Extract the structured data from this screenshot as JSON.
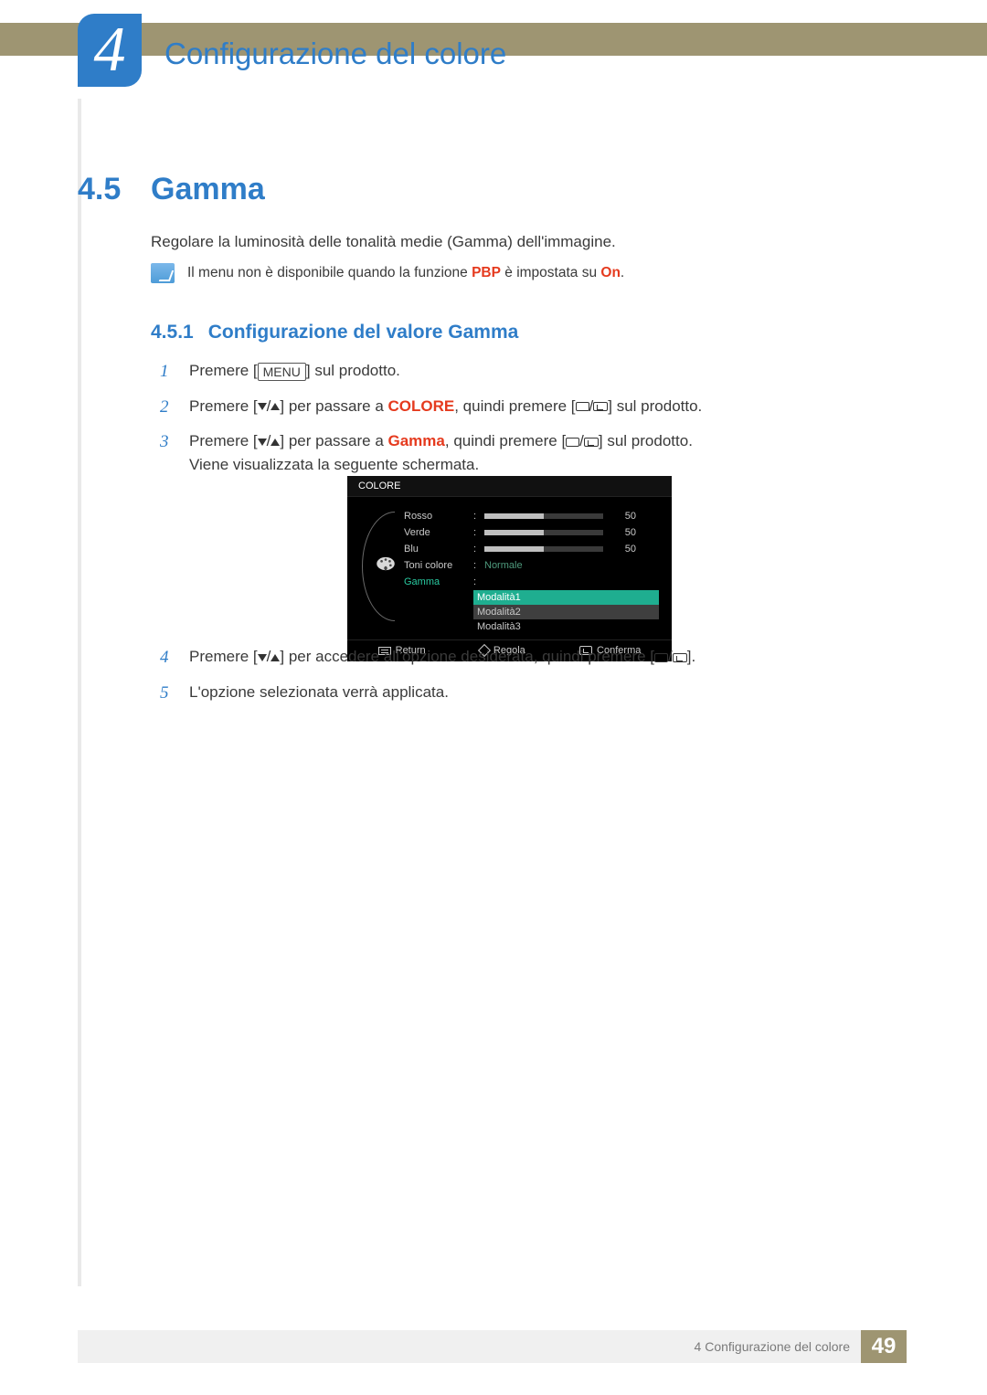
{
  "header": {
    "chapter_number": "4",
    "chapter_title": "Configurazione del colore"
  },
  "section": {
    "number": "4.5",
    "title": "Gamma",
    "intro": "Regolare la luminosità delle tonalità medie (Gamma) dell'immagine.",
    "note_pre": "Il menu non è disponibile quando la funzione ",
    "note_hl1": "PBP",
    "note_mid": " è impostata su ",
    "note_hl2": "On",
    "note_post": "."
  },
  "subsection": {
    "number": "4.5.1",
    "title": "Configurazione del valore Gamma"
  },
  "steps": {
    "s1_pre": "Premere [",
    "s1_menu": "MENU",
    "s1_post": "] sul prodotto.",
    "s2_pre": "Premere [",
    "s2_mid1": "] per passare a ",
    "s2_hl": "COLORE",
    "s2_mid2": ", quindi premere [",
    "s2_post": "] sul prodotto.",
    "s3_pre": "Premere [",
    "s3_mid1": "] per passare a ",
    "s3_hl": "Gamma",
    "s3_mid2": ", quindi premere [",
    "s3_post": "] sul prodotto.",
    "s3_line2": "Viene visualizzata la seguente schermata.",
    "s4_pre": "Premere [",
    "s4_mid": "] per accedere all'opzione desiderata, quindi premere [",
    "s4_post": "].",
    "s5": "L'opzione selezionata verrà applicata."
  },
  "osd": {
    "title": "COLORE",
    "rows": {
      "rosso": {
        "label": "Rosso",
        "value": "50",
        "pct": 50
      },
      "verde": {
        "label": "Verde",
        "value": "50",
        "pct": 50
      },
      "blu": {
        "label": "Blu",
        "value": "50",
        "pct": 50
      },
      "toni": {
        "label": "Toni colore",
        "value": "Normale"
      },
      "gamma": {
        "label": "Gamma"
      }
    },
    "options": [
      "Modalità1",
      "Modalità2",
      "Modalità3"
    ],
    "footer": {
      "return": "Return",
      "regola": "Regola",
      "conferma": "Conferma"
    }
  },
  "footer": {
    "text": "4  Configurazione del colore",
    "page": "49"
  }
}
